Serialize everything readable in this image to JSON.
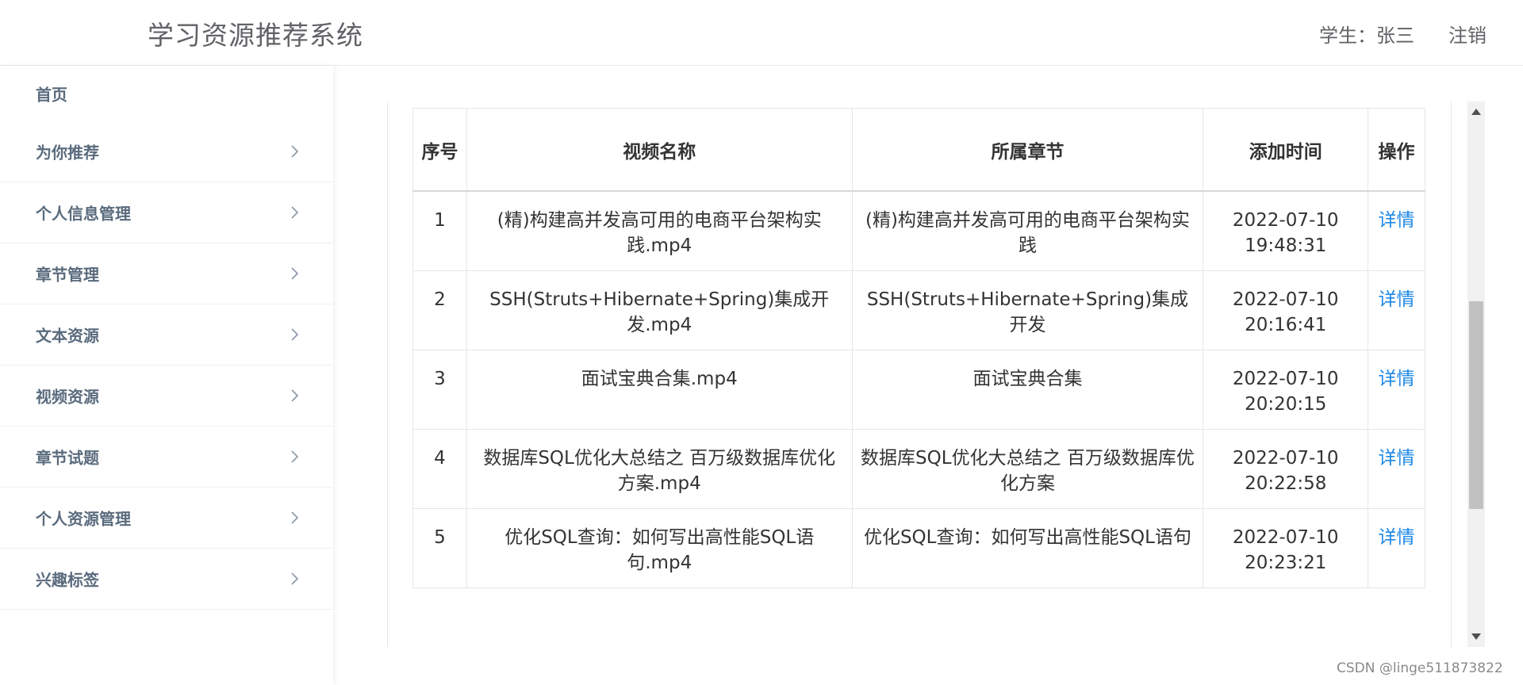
{
  "header": {
    "title": "学习资源推荐系统",
    "user": "学生：张三",
    "logout": "注销"
  },
  "sidebar": {
    "items": [
      {
        "label": "首页",
        "has_arrow": false
      },
      {
        "label": "为你推荐",
        "has_arrow": true
      },
      {
        "label": "个人信息管理",
        "has_arrow": true
      },
      {
        "label": "章节管理",
        "has_arrow": true
      },
      {
        "label": "文本资源",
        "has_arrow": true
      },
      {
        "label": "视频资源",
        "has_arrow": true
      },
      {
        "label": "章节试题",
        "has_arrow": true
      },
      {
        "label": "个人资源管理",
        "has_arrow": true
      },
      {
        "label": "兴趣标签",
        "has_arrow": true
      }
    ]
  },
  "table": {
    "headers": {
      "index": "序号",
      "video_name": "视频名称",
      "chapter": "所属章节",
      "added_time": "添加时间",
      "ops": "操作"
    },
    "rows": [
      {
        "index": "1",
        "video_name": "(精)构建高并发高可用的电商平台架构实践.mp4",
        "chapter": "(精)构建高并发高可用的电商平台架构实践",
        "added_time": "2022-07-10 19:48:31",
        "action": "详情"
      },
      {
        "index": "2",
        "video_name": "SSH(Struts+Hibernate+Spring)集成开发.mp4",
        "chapter": "SSH(Struts+Hibernate+Spring)集成开发",
        "added_time": "2022-07-10 20:16:41",
        "action": "详情"
      },
      {
        "index": "3",
        "video_name": "面试宝典合集.mp4",
        "chapter": "面试宝典合集",
        "added_time": "2022-07-10 20:20:15",
        "action": "详情"
      },
      {
        "index": "4",
        "video_name": "数据库SQL优化大总结之 百万级数据库优化方案.mp4",
        "chapter": "数据库SQL优化大总结之 百万级数据库优化方案",
        "added_time": "2022-07-10 20:22:58",
        "action": "详情"
      },
      {
        "index": "5",
        "video_name": "优化SQL查询：如何写出高性能SQL语句.mp4",
        "chapter": "优化SQL查询：如何写出高性能SQL语句",
        "added_time": "2022-07-10 20:23:21",
        "action": "详情"
      }
    ]
  },
  "watermark": "CSDN @linge511873822",
  "colors": {
    "link": "#1e88e5",
    "sidebar_text": "#5a6b7d",
    "header_text": "#606266"
  }
}
